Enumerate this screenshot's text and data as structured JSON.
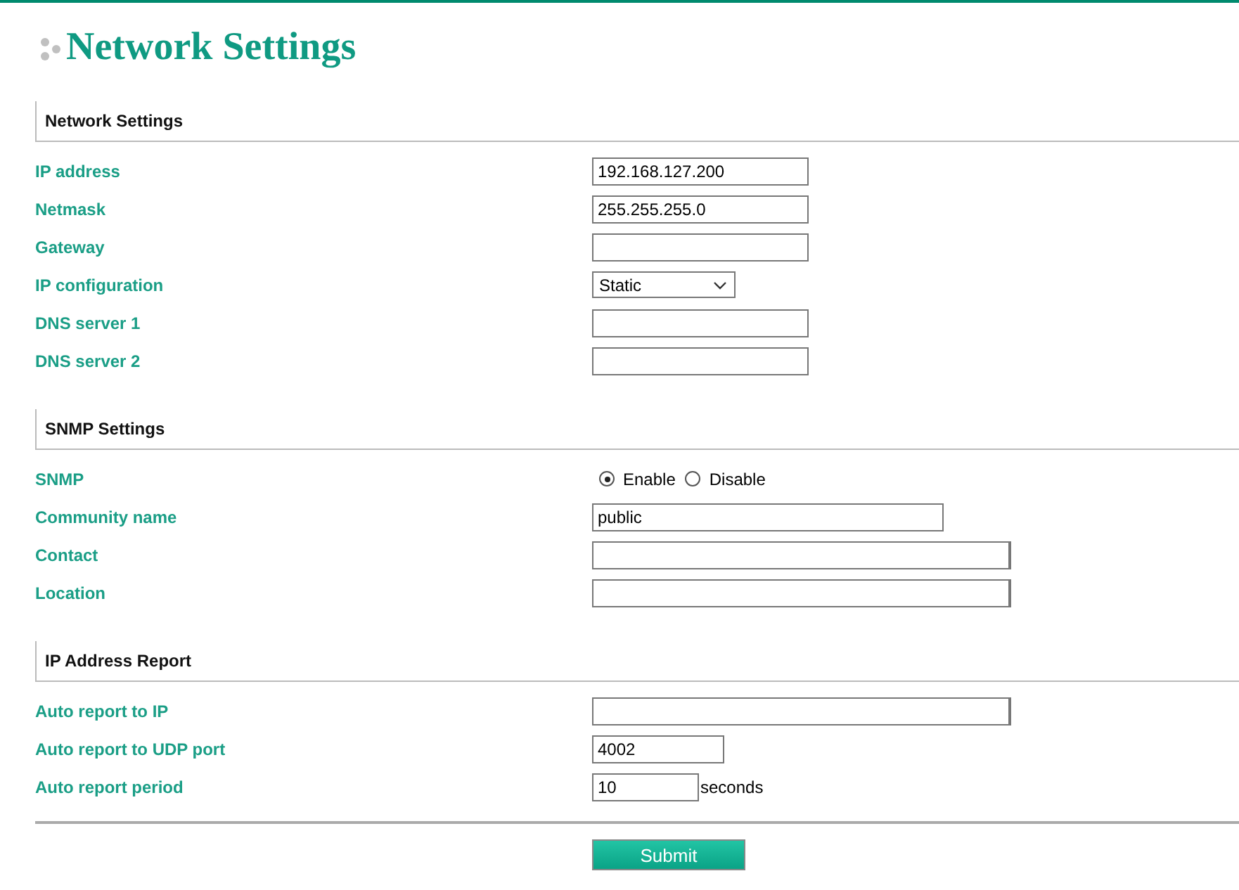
{
  "page_title": "Network Settings",
  "sections": [
    {
      "title": "Network Settings",
      "fields": [
        {
          "label": "IP address",
          "kind": "text",
          "value": "192.168.127.200"
        },
        {
          "label": "Netmask",
          "kind": "text",
          "value": "255.255.255.0"
        },
        {
          "label": "Gateway",
          "kind": "text"
        },
        {
          "label": "IP configuration",
          "kind": "select",
          "value": "Static"
        },
        {
          "label": "DNS server 1",
          "kind": "text"
        },
        {
          "label": "DNS server 2",
          "kind": "text"
        }
      ]
    },
    {
      "title": "SNMP Settings",
      "fields": [
        {
          "label": "SNMP",
          "kind": "radio",
          "options": [
            {
              "label": "Enable",
              "selected": true
            },
            {
              "label": "Disable",
              "selected": false
            }
          ]
        },
        {
          "label": "Community name",
          "kind": "text",
          "value": "public"
        },
        {
          "label": "Contact",
          "kind": "text"
        },
        {
          "label": "Location",
          "kind": "text"
        }
      ]
    },
    {
      "title": "IP Address Report",
      "fields": [
        {
          "label": "Auto report to IP",
          "kind": "text"
        },
        {
          "label": "Auto report to UDP port",
          "kind": "text",
          "value": "4002"
        },
        {
          "label": "Auto report period",
          "kind": "text",
          "value": "10",
          "unit": "seconds"
        }
      ]
    }
  ],
  "submit": "Submit"
}
